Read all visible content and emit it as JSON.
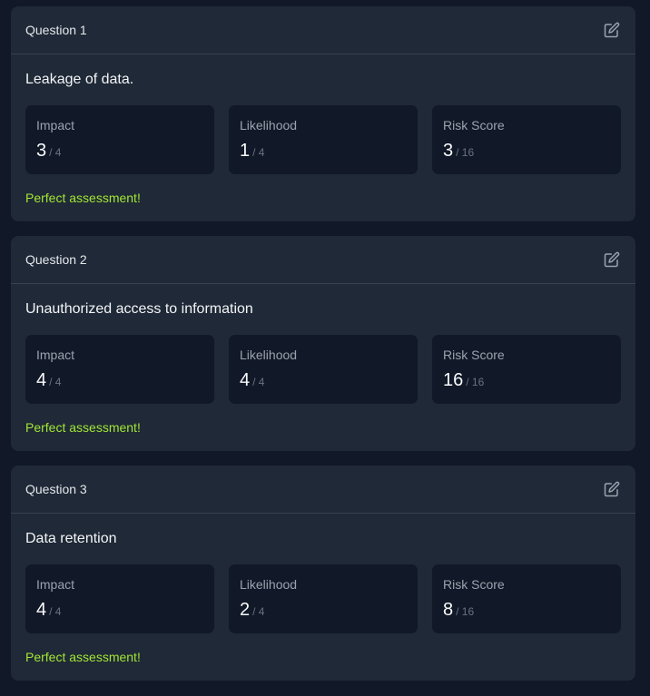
{
  "colors": {
    "page_background": "#111827",
    "card_background": "#1f2937",
    "metric_background": "#111827",
    "success_text": "#a3e635",
    "edit_icon": "#9ca3af"
  },
  "questions": [
    {
      "title": "Question 1",
      "text": "Leakage of data.",
      "edit_icon": "edit-square-pencil-icon",
      "metrics": [
        {
          "label": "Impact",
          "value": "3",
          "max": "/ 4"
        },
        {
          "label": "Likelihood",
          "value": "1",
          "max": "/ 4"
        },
        {
          "label": "Risk Score",
          "value": "3",
          "max": "/ 16"
        }
      ],
      "feedback": "Perfect assessment!"
    },
    {
      "title": "Question 2",
      "text": "Unauthorized access to information",
      "edit_icon": "edit-square-pencil-icon",
      "metrics": [
        {
          "label": "Impact",
          "value": "4",
          "max": "/ 4"
        },
        {
          "label": "Likelihood",
          "value": "4",
          "max": "/ 4"
        },
        {
          "label": "Risk Score",
          "value": "16",
          "max": "/ 16"
        }
      ],
      "feedback": "Perfect assessment!"
    },
    {
      "title": "Question 3",
      "text": "Data retention",
      "edit_icon": "edit-square-pencil-icon",
      "metrics": [
        {
          "label": "Impact",
          "value": "4",
          "max": "/ 4"
        },
        {
          "label": "Likelihood",
          "value": "2",
          "max": "/ 4"
        },
        {
          "label": "Risk Score",
          "value": "8",
          "max": "/ 16"
        }
      ],
      "feedback": "Perfect assessment!"
    }
  ]
}
